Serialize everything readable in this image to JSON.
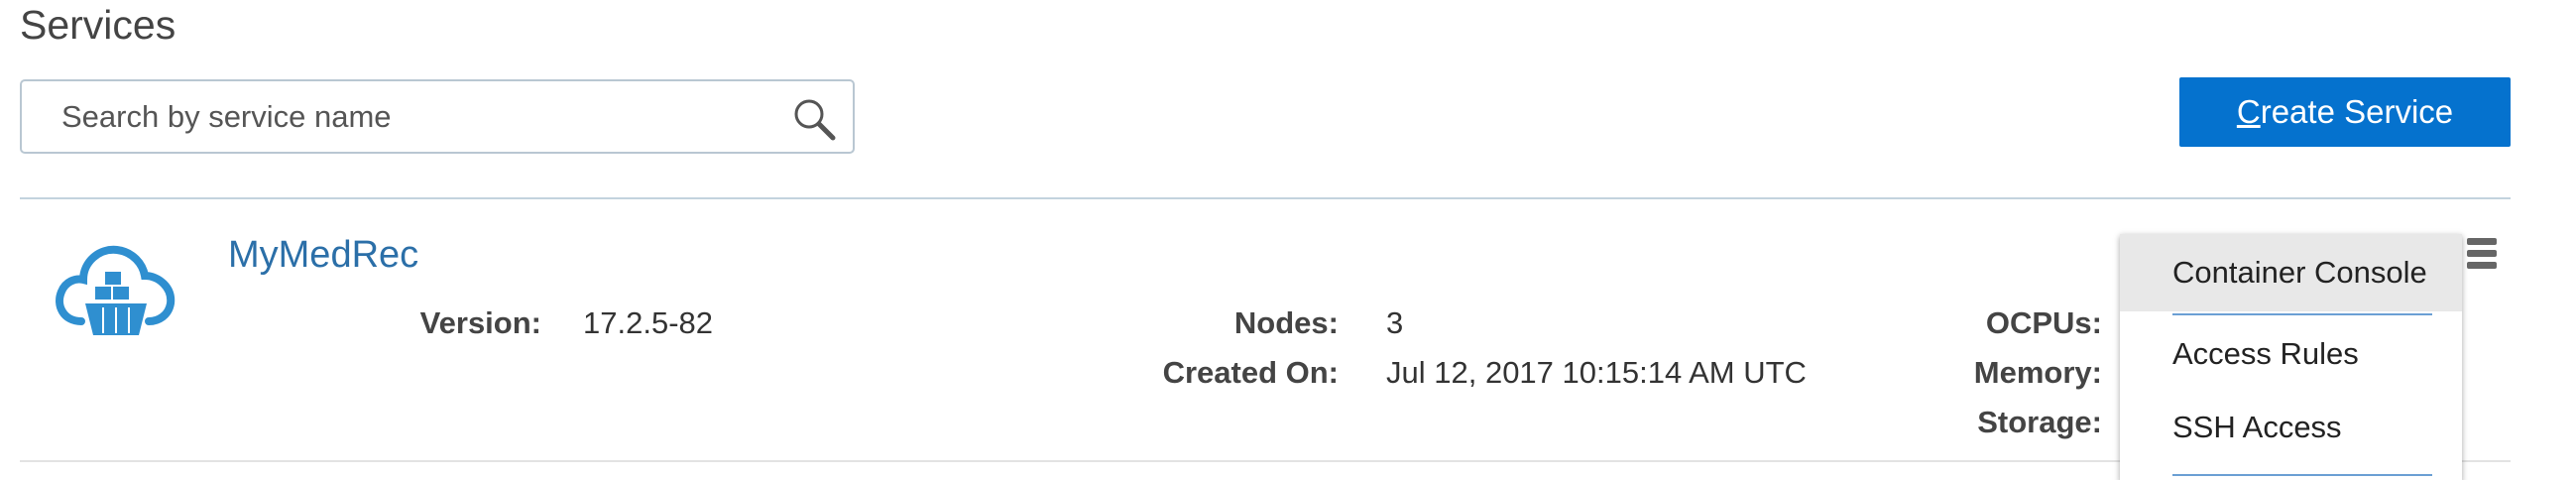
{
  "page": {
    "title": "Services"
  },
  "search": {
    "placeholder": "Search by service name",
    "value": ""
  },
  "toolbar": {
    "create_mnemonic": "C",
    "create_rest": "reate Service"
  },
  "service": {
    "name": "MyMedRec",
    "fields": {
      "version_label": "Version:",
      "version_value": "17.2.5-82",
      "nodes_label": "Nodes:",
      "nodes_value": "3",
      "created_label": "Created On:",
      "created_value": "Jul 12, 2017 10:15:14 AM UTC",
      "ocpus_label": "OCPUs:",
      "memory_label": "Memory:",
      "storage_label": "Storage:"
    }
  },
  "menu": {
    "items": [
      {
        "label": "Container Console",
        "active": true
      },
      {
        "label": "Access Rules",
        "active": false
      },
      {
        "label": "SSH Access",
        "active": false
      }
    ]
  },
  "icons": {
    "search": "search-icon",
    "service": "cloud-container-icon",
    "menu": "hamburger-menu-icon"
  },
  "colors": {
    "accent": "#0572ce",
    "link": "#2b6fa8",
    "icon": "#2f8fd0"
  }
}
